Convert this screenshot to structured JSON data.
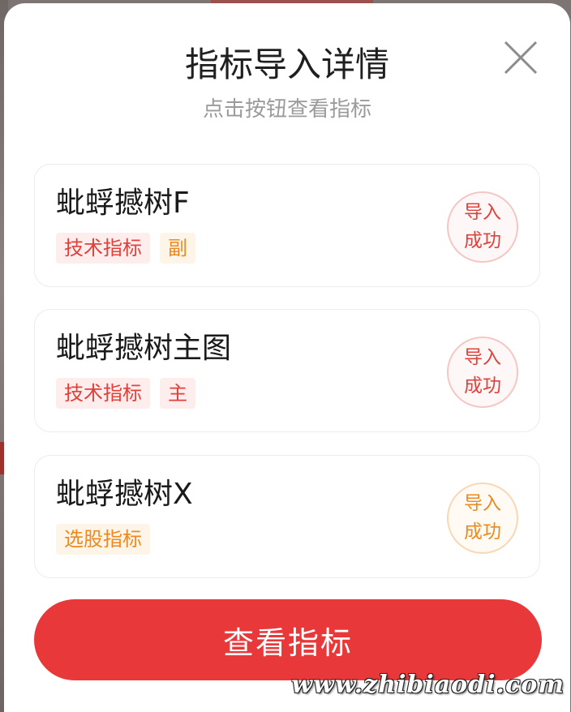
{
  "dialog": {
    "title": "指标导入详情",
    "subtitle": "点击按钮查看指标",
    "close_icon": "close-icon"
  },
  "items": [
    {
      "name": "蚍蜉撼树F",
      "tags": [
        {
          "label": "技术指标",
          "color": "#e2403a"
        },
        {
          "label": "副",
          "color": "#ec8a1f"
        }
      ],
      "status_line1": "导入",
      "status_line2": "成功",
      "status_color": "#e2403a"
    },
    {
      "name": "蚍蜉撼树主图",
      "tags": [
        {
          "label": "技术指标",
          "color": "#e2403a"
        },
        {
          "label": "主",
          "color": "#e2403a"
        }
      ],
      "status_line1": "导入",
      "status_line2": "成功",
      "status_color": "#e2403a"
    },
    {
      "name": "蚍蜉撼树X",
      "tags": [
        {
          "label": "选股指标",
          "color": "#ec8a1f"
        }
      ],
      "status_line1": "导入",
      "status_line2": "成功",
      "status_color": "#ec8a1f"
    }
  ],
  "view_button": {
    "label": "查看指标",
    "color": "#e8383a"
  },
  "watermark": "www.zhibiaodi.com"
}
